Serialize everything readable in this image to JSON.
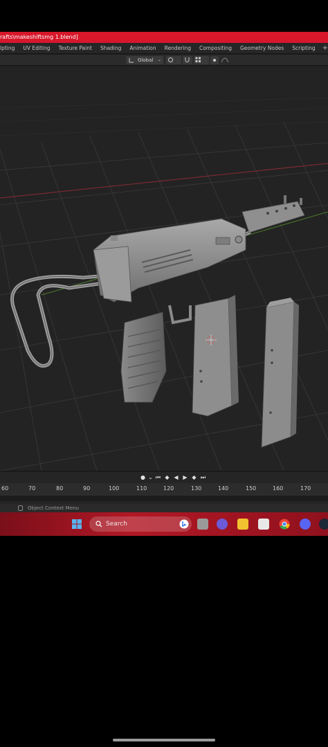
{
  "window": {
    "title": "rafts\\makeshiftsmg 1.blend]"
  },
  "workspaces": {
    "tabs": [
      "lpting",
      "UV Editing",
      "Texture Paint",
      "Shading",
      "Animation",
      "Rendering",
      "Compositing",
      "Geometry Nodes",
      "Scripting"
    ],
    "add_label": "+"
  },
  "header": {
    "orientation_label": "Global"
  },
  "timeline": {
    "frames": [
      "60",
      "70",
      "80",
      "90",
      "100",
      "110",
      "120",
      "130",
      "140",
      "150",
      "160",
      "170"
    ]
  },
  "statusbar": {
    "hint": "Object Context Menu"
  },
  "taskbar": {
    "search_placeholder": "Search"
  },
  "colors": {
    "title_bar": "#d7172a",
    "taskbar": "#b21825",
    "viewport_bg": "#232323"
  }
}
